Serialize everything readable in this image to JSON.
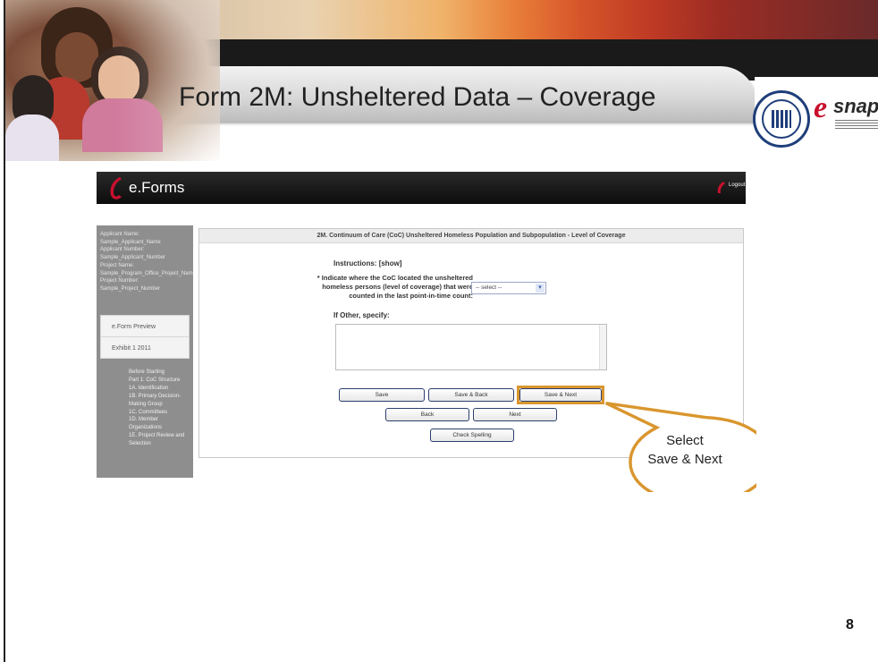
{
  "slide": {
    "title": "Form 2M: Unsheltered Data – Coverage",
    "page_number": "8",
    "logos": [
      "hud-seal-icon",
      "esnaps-logo"
    ],
    "esnaps_wordmark": "snaps",
    "esnaps_subtitle": "Homeless Assistance Applications and Grants Management System"
  },
  "app": {
    "name": "e.Forms",
    "logout_label": "Logout"
  },
  "sidebar": {
    "info": [
      "Applicant Name:",
      "Sample_Applicant_Name",
      "Applicant Number:",
      "Sample_Applicant_Number",
      "Project Name:",
      "Sample_Program_Office_Project_Name",
      "Project Number:",
      "Sample_Project_Number"
    ],
    "tabs": [
      "e.Form Preview",
      "Exhibit 1 2011"
    ],
    "nav": [
      "Before Starting",
      "Part 1: CoC Structure",
      "1A. Identification",
      "1B. Primary Decision-",
      "Making Group",
      "1C. Committees",
      "1D. Member",
      "Organizations",
      "1E. Project Review and",
      "Selection"
    ]
  },
  "form": {
    "header": "2M. Continuum of Care (CoC) Unsheltered Homeless Population and Subpopulation - Level of Coverage",
    "instructions_label": "Instructions:",
    "instructions_link": "[show]",
    "question": {
      "required_mark": "*",
      "line1": "Indicate where the CoC located the unsheltered",
      "line2": "homeless persons (level of coverage) that were",
      "line3": "counted in the last point-in-time count:",
      "select_value": "-- select --"
    },
    "other_label": "If Other, specify:",
    "other_value": "",
    "buttons": {
      "save": "Save",
      "save_back": "Save & Back",
      "save_next": "Save & Next",
      "back": "Back",
      "next": "Next",
      "check_spelling": "Check Spelling"
    }
  },
  "callout": {
    "line1": "Select",
    "line2": "Save & Next",
    "border_color": "#d9962e"
  }
}
